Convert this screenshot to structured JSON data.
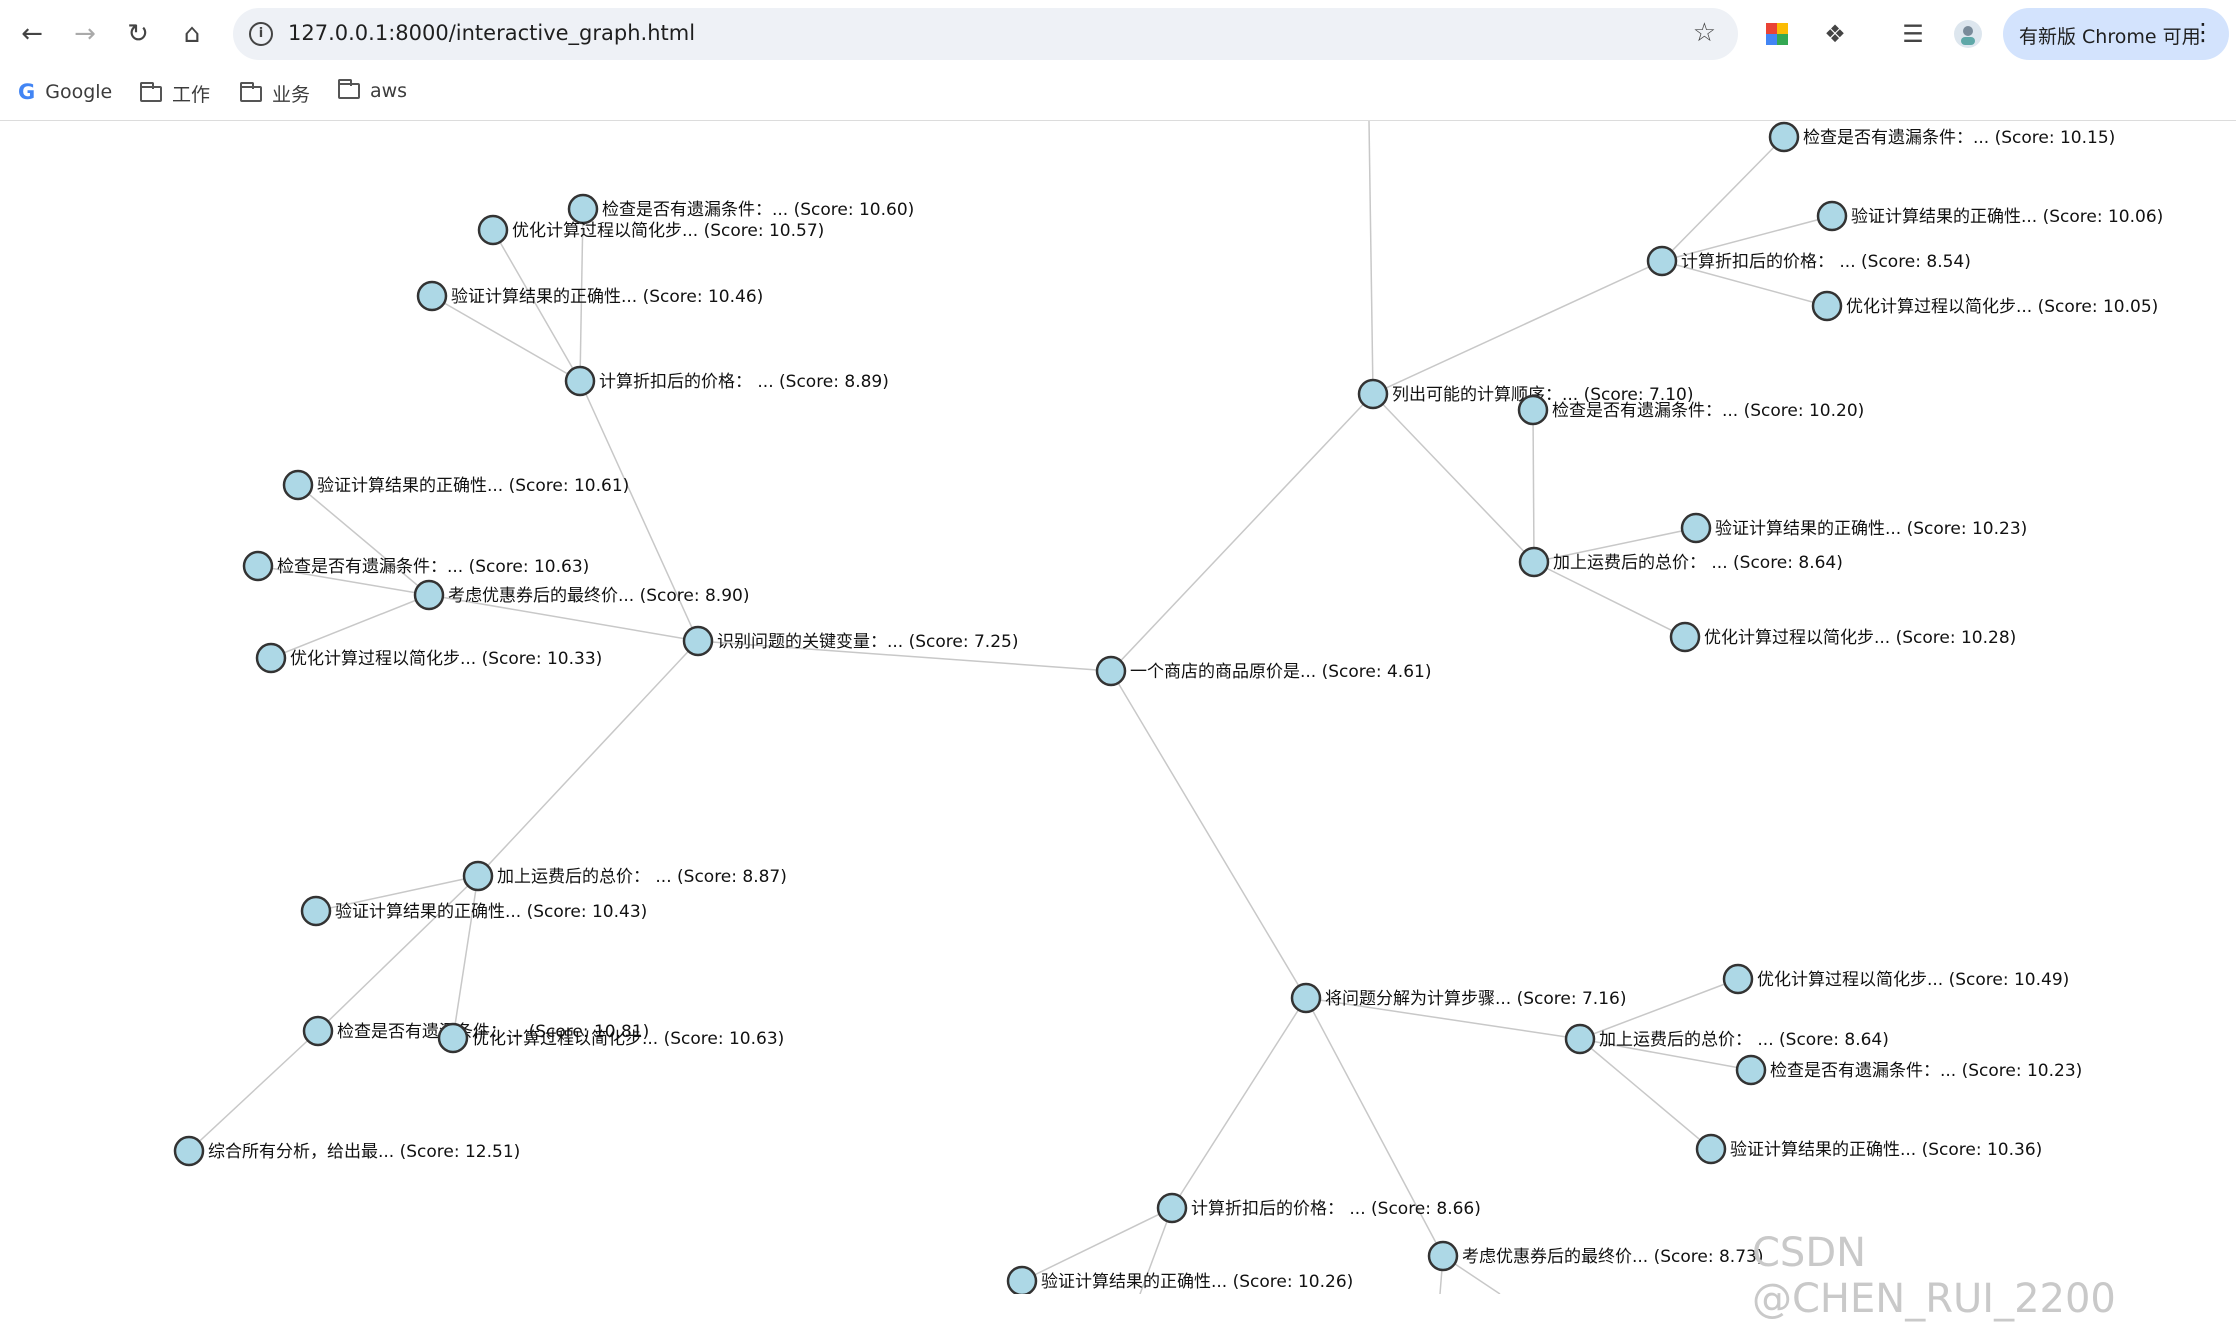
{
  "browser": {
    "url": "127.0.0.1:8000/interactive_graph.html",
    "update_label": "有新版 Chrome 可用"
  },
  "bookmarks": [
    {
      "label": "Google"
    },
    {
      "label": "工作"
    },
    {
      "label": "业务"
    },
    {
      "label": "aws"
    }
  ],
  "graph": {
    "node_color": "#add8e6",
    "edge_color": "#c8c8c8",
    "nodes": [
      {
        "id": "root",
        "label": "一个商店的商品原价是... (Score: 4.61)"
      },
      {
        "id": "n1",
        "label": "识别问题的关键变量：... (Score: 7.25)"
      },
      {
        "id": "n2",
        "label": "列出可能的计算顺序：... (Score: 7.10)"
      },
      {
        "id": "n3",
        "label": "将问题分解为计算步骤... (Score: 7.16)"
      },
      {
        "id": "n1a",
        "label": "计算折扣后的价格：  ... (Score: 8.89)"
      },
      {
        "id": "n1a1",
        "label": "检查是否有遗漏条件：... (Score: 10.60)"
      },
      {
        "id": "n1a2",
        "label": "优化计算过程以简化步... (Score: 10.57)"
      },
      {
        "id": "n1a3",
        "label": "验证计算结果的正确性... (Score: 10.46)"
      },
      {
        "id": "n1b",
        "label": "考虑优惠券后的最终价... (Score: 8.90)"
      },
      {
        "id": "n1b1",
        "label": "验证计算结果的正确性... (Score: 10.61)"
      },
      {
        "id": "n1b2",
        "label": "检查是否有遗漏条件：... (Score: 10.63)"
      },
      {
        "id": "n1b3",
        "label": "优化计算过程以简化步... (Score: 10.33)"
      },
      {
        "id": "n1c",
        "label": "加上运费后的总价：  ... (Score: 8.87)"
      },
      {
        "id": "n1c1",
        "label": "验证计算结果的正确性... (Score: 10.43)"
      },
      {
        "id": "n1c2",
        "label": "检查是否有遗漏条件：... (Score: 10.81)"
      },
      {
        "id": "n1c3",
        "label": "优化计算过程以简化步... (Score: 10.63)"
      },
      {
        "id": "n1c2a",
        "label": "综合所有分析，给出最... (Score: 12.51)"
      },
      {
        "id": "n2a",
        "label": "计算折扣后的价格：  ... (Score: 8.54)"
      },
      {
        "id": "n2a1",
        "label": "检查是否有遗漏条件：... (Score: 10.15)"
      },
      {
        "id": "n2a2",
        "label": "验证计算结果的正确性... (Score: 10.06)"
      },
      {
        "id": "n2a3",
        "label": "优化计算过程以简化步... (Score: 10.05)"
      },
      {
        "id": "n2b",
        "label": "加上运费后的总价：  ... (Score: 8.64)"
      },
      {
        "id": "n2b1",
        "label": "检查是否有遗漏条件：... (Score: 10.20)"
      },
      {
        "id": "n2b2",
        "label": "验证计算结果的正确性... (Score: 10.23)"
      },
      {
        "id": "n2b3",
        "label": "优化计算过程以简化步... (Score: 10.28)"
      },
      {
        "id": "n3a",
        "label": "加上运费后的总价：  ... (Score: 8.64)"
      },
      {
        "id": "n3a1",
        "label": "优化计算过程以简化步... (Score: 10.49)"
      },
      {
        "id": "n3a2",
        "label": "检查是否有遗漏条件：... (Score: 10.23)"
      },
      {
        "id": "n3a3",
        "label": "验证计算结果的正确性... (Score: 10.36)"
      },
      {
        "id": "n3b",
        "label": "计算折扣后的价格：  ... (Score: 8.66)"
      },
      {
        "id": "n3b1",
        "label": "验证计算结果的正确性... (Score: 10.26)"
      },
      {
        "id": "n3c",
        "label": "考虑优惠券后的最终价... (Score: 8.73)"
      }
    ],
    "edges": [
      [
        "root",
        "n1"
      ],
      [
        "root",
        "n2"
      ],
      [
        "root",
        "n3"
      ],
      [
        "n1",
        "n1a"
      ],
      [
        "n1",
        "n1b"
      ],
      [
        "n1",
        "n1c"
      ],
      [
        "n1a",
        "n1a1"
      ],
      [
        "n1a",
        "n1a2"
      ],
      [
        "n1a",
        "n1a3"
      ],
      [
        "n1b",
        "n1b1"
      ],
      [
        "n1b",
        "n1b2"
      ],
      [
        "n1b",
        "n1b3"
      ],
      [
        "n1c",
        "n1c1"
      ],
      [
        "n1c",
        "n1c2"
      ],
      [
        "n1c",
        "n1c3"
      ],
      [
        "n1c2",
        "n1c2a"
      ],
      [
        "n2",
        "n2a"
      ],
      [
        "n2",
        "n2b"
      ],
      [
        "n2a",
        "n2a1"
      ],
      [
        "n2a",
        "n2a2"
      ],
      [
        "n2a",
        "n2a3"
      ],
      [
        "n2b",
        "n2b1"
      ],
      [
        "n2b",
        "n2b2"
      ],
      [
        "n2b",
        "n2b3"
      ],
      [
        "n3",
        "n3a"
      ],
      [
        "n3",
        "n3b"
      ],
      [
        "n3",
        "n3c"
      ],
      [
        "n3a",
        "n3a1"
      ],
      [
        "n3a",
        "n3a2"
      ],
      [
        "n3a",
        "n3a3"
      ],
      [
        "n3b",
        "n3b1"
      ]
    ]
  },
  "watermark": "CSDN @CHEN_RUI_2200"
}
